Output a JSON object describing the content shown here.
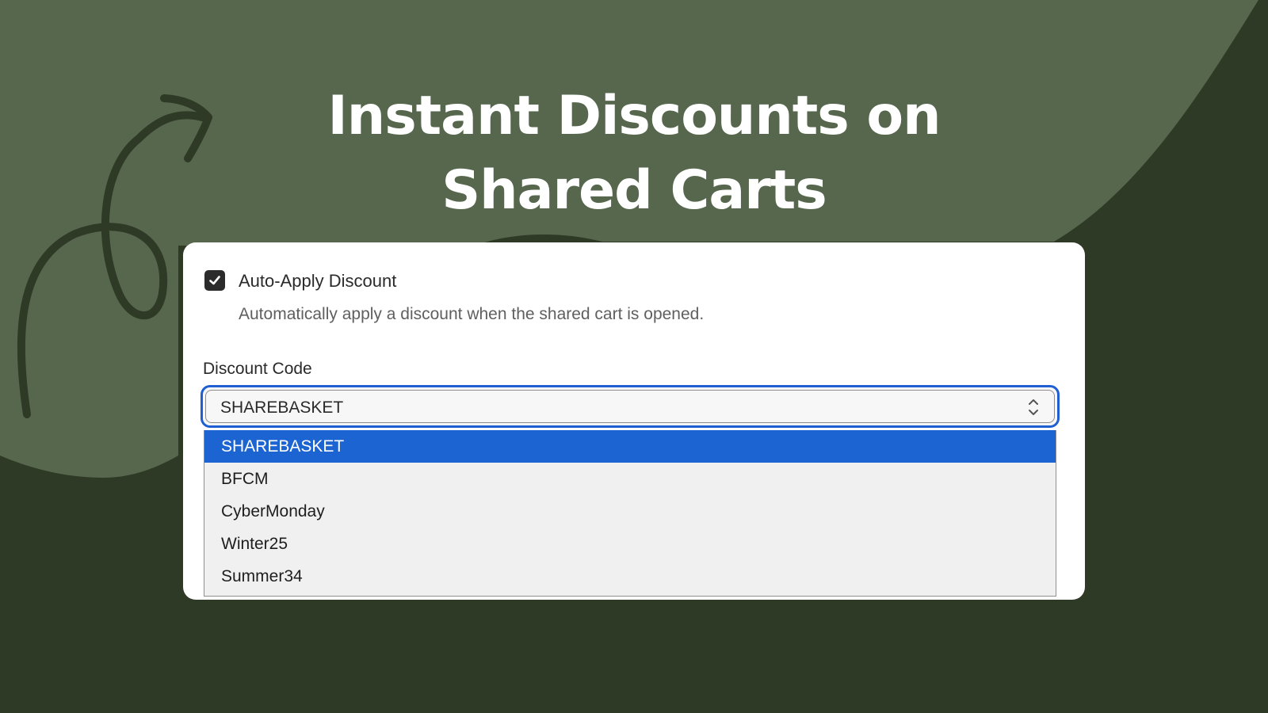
{
  "headline": {
    "line1": "Instant Discounts on",
    "line2": "Shared Carts"
  },
  "colors": {
    "background_dark": "#2e3926",
    "background_blob": "#56674d",
    "arrow": "#2e3926",
    "focus_ring": "#1f5fd1",
    "option_selected": "#1c64d2"
  },
  "decor": {
    "arrow_icon": "curly-arrow-icon"
  },
  "settings": {
    "auto_apply": {
      "checked": true,
      "label": "Auto-Apply Discount",
      "help_text": "Automatically apply a discount when the shared cart is opened.",
      "icon": "checkmark-icon"
    },
    "discount_code": {
      "label": "Discount Code",
      "selected_value": "SHAREBASKET",
      "icon": "chevron-up-down-icon",
      "options": [
        {
          "label": "SHAREBASKET",
          "selected": true
        },
        {
          "label": "BFCM",
          "selected": false
        },
        {
          "label": "CyberMonday",
          "selected": false
        },
        {
          "label": "Winter25",
          "selected": false
        },
        {
          "label": "Summer34",
          "selected": false
        }
      ]
    }
  }
}
